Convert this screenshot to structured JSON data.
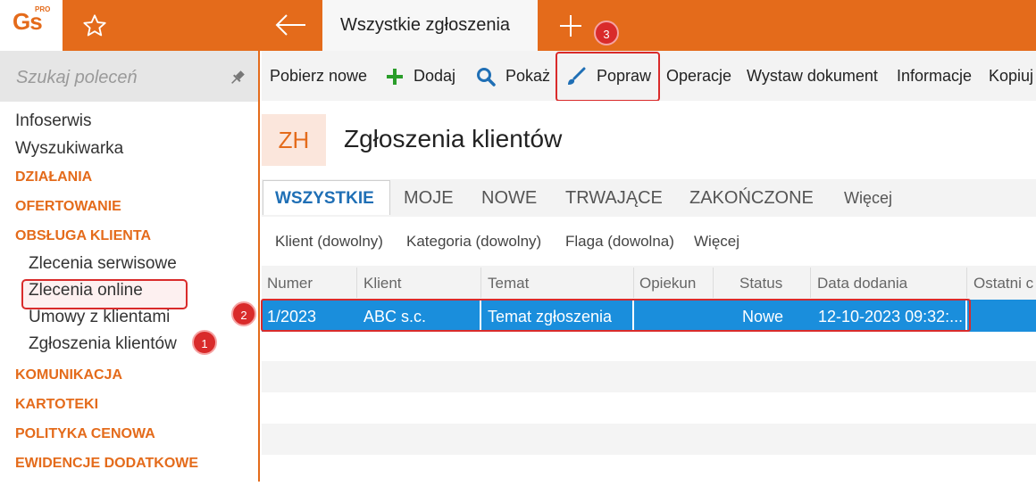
{
  "app": {
    "logo_text": "Gs",
    "logo_sup": "PRO"
  },
  "topbar": {
    "active_tab": "Wszystkie zgłoszenia"
  },
  "sidebar": {
    "search_placeholder": "Szukaj poleceń",
    "items": [
      {
        "label": "Infoserwis",
        "type": "item"
      },
      {
        "label": "Wyszukiwarka",
        "type": "item"
      },
      {
        "label": "DZIAŁANIA",
        "type": "section"
      },
      {
        "label": "OFERTOWANIE",
        "type": "section"
      },
      {
        "label": "OBSŁUGA KLIENTA",
        "type": "section"
      },
      {
        "label": "Zlecenia serwisowe",
        "type": "sub"
      },
      {
        "label": "Zlecenia online",
        "type": "sub"
      },
      {
        "label": "Umowy z klientami",
        "type": "sub"
      },
      {
        "label": "Zgłoszenia klientów",
        "type": "sub-selected"
      },
      {
        "label": "KOMUNIKACJA",
        "type": "section"
      },
      {
        "label": "KARTOTEKI",
        "type": "section"
      },
      {
        "label": "POLITYKA CENOWA",
        "type": "section"
      },
      {
        "label": "EWIDENCJE DODATKOWE",
        "type": "section"
      }
    ]
  },
  "toolbar": {
    "pobierz": "Pobierz nowe",
    "dodaj": "Dodaj",
    "pokaz": "Pokaż",
    "popraw": "Popraw",
    "operacje": "Operacje",
    "wystaw": "Wystaw dokument",
    "informacje": "Informacje",
    "kopiuj": "Kopiuj"
  },
  "header": {
    "badge": "ZH",
    "title": "Zgłoszenia klientów"
  },
  "view_tabs": [
    "WSZYSTKIE",
    "MOJE",
    "NOWE",
    "TRWAJĄCE",
    "ZAKOŃCZONE",
    "Więcej"
  ],
  "filters": [
    "Klient (dowolny)",
    "Kategoria (dowolny)",
    "Flaga (dowolna)",
    "Więcej"
  ],
  "grid": {
    "columns": [
      "Numer",
      "Klient",
      "Temat",
      "Opiekun",
      "Status",
      "Data dodania",
      "Ostatni c"
    ],
    "rows": [
      {
        "numer": "1/2023",
        "klient": "ABC s.c.",
        "temat": "Temat zgłoszenia",
        "opiekun": "",
        "status": "Nowe",
        "data": "12-10-2023 09:32:..."
      }
    ]
  },
  "annotations": [
    "1",
    "2",
    "3"
  ],
  "colors": {
    "accent": "#e46b1b",
    "selection": "#1a8edc",
    "highlight": "#d92b2b",
    "tab_active": "#1f6fb5"
  }
}
